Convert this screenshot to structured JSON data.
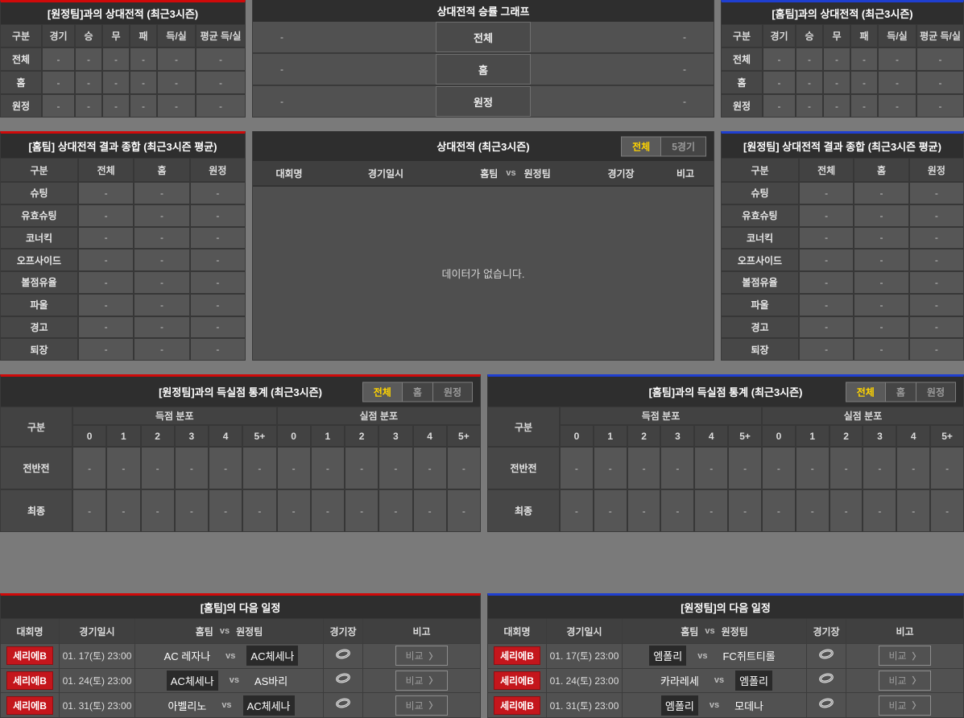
{
  "colors": {
    "accent_red": "#cf0a0a",
    "accent_blue": "#1f3fd0",
    "tab_active_text": "#ffd400",
    "badge_red": "#c4161c"
  },
  "h2h_away": {
    "title": "[원정팀]과의 상대전적 (최근3시즌)",
    "columns": [
      "구분",
      "경기",
      "승",
      "무",
      "패",
      "득/실",
      "평균 득/실"
    ],
    "rows": [
      {
        "label": "전체",
        "values": [
          "-",
          "-",
          "-",
          "-",
          "-",
          "-"
        ]
      },
      {
        "label": "홈",
        "values": [
          "-",
          "-",
          "-",
          "-",
          "-",
          "-"
        ]
      },
      {
        "label": "원정",
        "values": [
          "-",
          "-",
          "-",
          "-",
          "-",
          "-"
        ]
      }
    ]
  },
  "winrate": {
    "title": "상대전적 승률 그래프",
    "rows": [
      {
        "label": "전체",
        "left": "-",
        "right": "-"
      },
      {
        "label": "홈",
        "left": "-",
        "right": "-"
      },
      {
        "label": "원정",
        "left": "-",
        "right": "-"
      }
    ]
  },
  "h2h_home": {
    "title": "[홈팀]과의 상대전적 (최근3시즌)",
    "columns": [
      "구분",
      "경기",
      "승",
      "무",
      "패",
      "득/실",
      "평균 득/실"
    ],
    "rows": [
      {
        "label": "전체",
        "values": [
          "-",
          "-",
          "-",
          "-",
          "-",
          "-"
        ]
      },
      {
        "label": "홈",
        "values": [
          "-",
          "-",
          "-",
          "-",
          "-",
          "-"
        ]
      },
      {
        "label": "원정",
        "values": [
          "-",
          "-",
          "-",
          "-",
          "-",
          "-"
        ]
      }
    ]
  },
  "summary_home": {
    "title": "[홈팀] 상대전적 결과 종합 (최근3시즌 평균)",
    "columns": [
      "구분",
      "전체",
      "홈",
      "원정"
    ],
    "rows": [
      {
        "label": "슈팅",
        "values": [
          "-",
          "-",
          "-"
        ]
      },
      {
        "label": "유효슈팅",
        "values": [
          "-",
          "-",
          "-"
        ]
      },
      {
        "label": "코너킥",
        "values": [
          "-",
          "-",
          "-"
        ]
      },
      {
        "label": "오프사이드",
        "values": [
          "-",
          "-",
          "-"
        ]
      },
      {
        "label": "볼점유율",
        "values": [
          "-",
          "-",
          "-"
        ]
      },
      {
        "label": "파울",
        "values": [
          "-",
          "-",
          "-"
        ]
      },
      {
        "label": "경고",
        "values": [
          "-",
          "-",
          "-"
        ]
      },
      {
        "label": "퇴장",
        "values": [
          "-",
          "-",
          "-"
        ]
      }
    ]
  },
  "summary_away": {
    "title": "[원정팀] 상대전적 결과 종합 (최근3시즌 평균)",
    "columns": [
      "구분",
      "전체",
      "홈",
      "원정"
    ],
    "rows": [
      {
        "label": "슈팅",
        "values": [
          "-",
          "-",
          "-"
        ]
      },
      {
        "label": "유효슈팅",
        "values": [
          "-",
          "-",
          "-"
        ]
      },
      {
        "label": "코너킥",
        "values": [
          "-",
          "-",
          "-"
        ]
      },
      {
        "label": "오프사이드",
        "values": [
          "-",
          "-",
          "-"
        ]
      },
      {
        "label": "볼점유율",
        "values": [
          "-",
          "-",
          "-"
        ]
      },
      {
        "label": "파울",
        "values": [
          "-",
          "-",
          "-"
        ]
      },
      {
        "label": "경고",
        "values": [
          "-",
          "-",
          "-"
        ]
      },
      {
        "label": "퇴장",
        "values": [
          "-",
          "-",
          "-"
        ]
      }
    ]
  },
  "h2h_list": {
    "title": "상대전적 (최근3시즌)",
    "tabs": [
      {
        "label": "전체",
        "active": true
      },
      {
        "label": "5경기",
        "active": false
      }
    ],
    "col_league": "대회명",
    "col_datetime": "경기일시",
    "col_home": "홈팀",
    "col_vs": "vs",
    "col_away": "원정팀",
    "col_stadium": "경기장",
    "col_note": "비고",
    "empty": "데이터가 없습니다."
  },
  "goals_away": {
    "title": "[원정팀]과의 득실점 통계 (최근3시즌)",
    "tabs": [
      {
        "label": "전체",
        "active": true
      },
      {
        "label": "홈",
        "active": false
      },
      {
        "label": "원정",
        "active": false
      }
    ],
    "col_group": "구분",
    "group_scored": "득점 분포",
    "group_conceded": "실점 분포",
    "score_cols": [
      "0",
      "1",
      "2",
      "3",
      "4",
      "5+"
    ],
    "rows": [
      {
        "label": "전반전",
        "values": [
          "-",
          "-",
          "-",
          "-",
          "-",
          "-",
          "-",
          "-",
          "-",
          "-",
          "-",
          "-"
        ]
      },
      {
        "label": "최종",
        "values": [
          "-",
          "-",
          "-",
          "-",
          "-",
          "-",
          "-",
          "-",
          "-",
          "-",
          "-",
          "-"
        ]
      }
    ]
  },
  "goals_home": {
    "title": "[홈팀]과의 득실점 통계 (최근3시즌)",
    "tabs": [
      {
        "label": "전체",
        "active": true
      },
      {
        "label": "홈",
        "active": false
      },
      {
        "label": "원정",
        "active": false
      }
    ],
    "col_group": "구분",
    "group_scored": "득점 분포",
    "group_conceded": "실점 분포",
    "score_cols": [
      "0",
      "1",
      "2",
      "3",
      "4",
      "5+"
    ],
    "rows": [
      {
        "label": "전반전",
        "values": [
          "-",
          "-",
          "-",
          "-",
          "-",
          "-",
          "-",
          "-",
          "-",
          "-",
          "-",
          "-"
        ]
      },
      {
        "label": "최종",
        "values": [
          "-",
          "-",
          "-",
          "-",
          "-",
          "-",
          "-",
          "-",
          "-",
          "-",
          "-",
          "-"
        ]
      }
    ]
  },
  "schedule_home": {
    "title": "[홈팀]의 다음 일정",
    "col_league": "대회명",
    "col_datetime": "경기일시",
    "col_home": "홈팀",
    "col_vs": "vs",
    "col_away": "원정팀",
    "col_stadium": "경기장",
    "col_note": "비고",
    "vs_label": "vs",
    "compare_label": "비교",
    "chevron": "〉",
    "rows": [
      {
        "league": "세리에B",
        "datetime": "01. 17(토) 23:00",
        "home": {
          "text": "AC 레자나",
          "hl": false
        },
        "away": {
          "text": "AC체세나",
          "hl": true
        }
      },
      {
        "league": "세리에B",
        "datetime": "01. 24(토) 23:00",
        "home": {
          "text": "AC체세나",
          "hl": true
        },
        "away": {
          "text": "AS바리",
          "hl": false
        }
      },
      {
        "league": "세리에B",
        "datetime": "01. 31(토) 23:00",
        "home": {
          "text": "아벨리노",
          "hl": false
        },
        "away": {
          "text": "AC체세나",
          "hl": true
        }
      }
    ]
  },
  "schedule_away": {
    "title": "[원정팀]의 다음 일정",
    "col_league": "대회명",
    "col_datetime": "경기일시",
    "col_home": "홈팀",
    "col_vs": "vs",
    "col_away": "원정팀",
    "col_stadium": "경기장",
    "col_note": "비고",
    "vs_label": "vs",
    "compare_label": "비교",
    "chevron": "〉",
    "rows": [
      {
        "league": "세리에B",
        "datetime": "01. 17(토) 23:00",
        "home": {
          "text": "엠폴리",
          "hl": true
        },
        "away": {
          "text": "FC쥐트티롤",
          "hl": false
        }
      },
      {
        "league": "세리에B",
        "datetime": "01. 24(토) 23:00",
        "home": {
          "text": "카라레세",
          "hl": false
        },
        "away": {
          "text": "엠폴리",
          "hl": true
        }
      },
      {
        "league": "세리에B",
        "datetime": "01. 31(토) 23:00",
        "home": {
          "text": "엠폴리",
          "hl": true
        },
        "away": {
          "text": "모데나",
          "hl": false
        }
      }
    ]
  }
}
